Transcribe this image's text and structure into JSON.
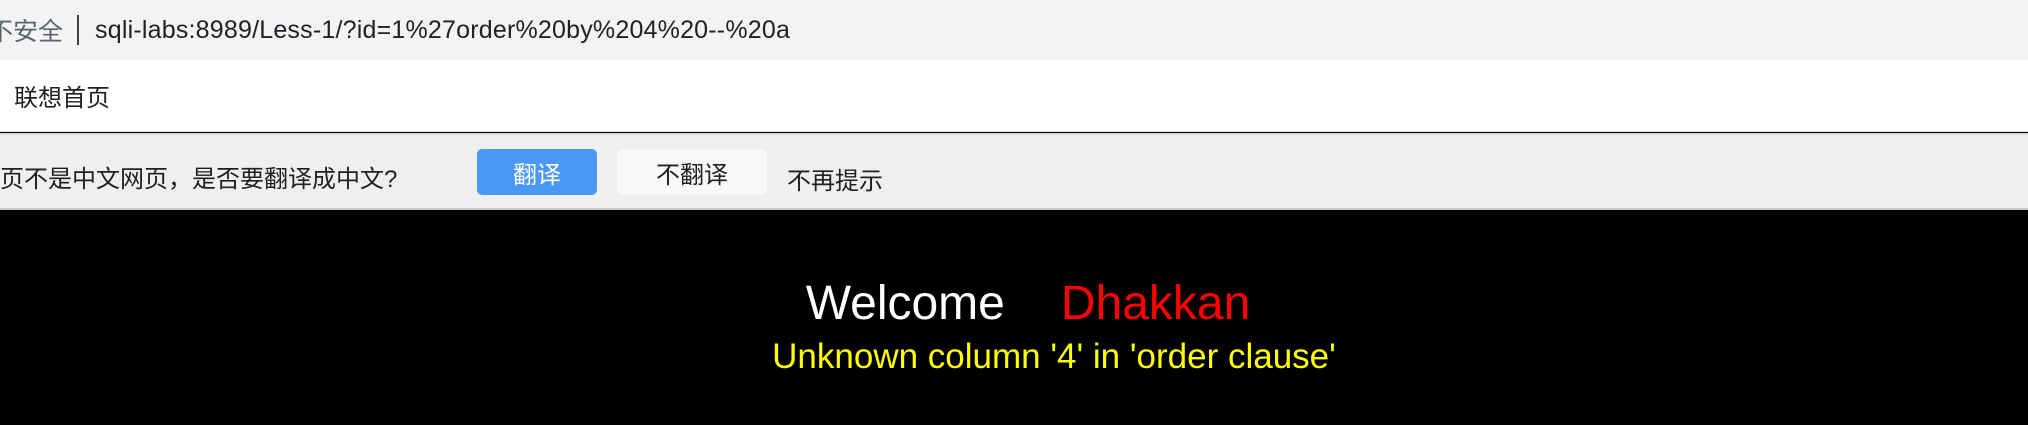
{
  "browser": {
    "security_label": "不安全",
    "url": "sqli-labs:8989/Less-1/?id=1%27order%20by%204%20--%20a"
  },
  "bookmarks": {
    "items": [
      {
        "label": "联想首页"
      }
    ]
  },
  "translate_bar": {
    "prompt": "页不是中文网页，是否要翻译成中文?",
    "translate_button": "翻译",
    "no_translate_button": "不翻译",
    "never_show": "不再提示"
  },
  "page": {
    "welcome": "Welcome",
    "name": "Dhakkan",
    "message": "Unknown column '4' in 'order clause'"
  },
  "colors": {
    "background": "#000000",
    "welcome": "#ffffff",
    "name": "#ff0000",
    "message": "#ffff00",
    "translate_button": "#4a98f7"
  }
}
